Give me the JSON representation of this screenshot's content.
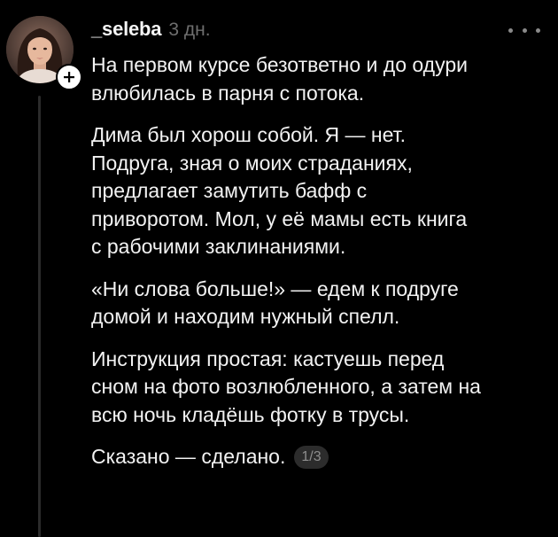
{
  "author": {
    "username": "_seleba",
    "time_ago": "3 дн."
  },
  "icons": {
    "avatar": "user-avatar-photo",
    "follow": "plus-icon",
    "more": "more-horizontal-icon"
  },
  "post": {
    "paragraphs": [
      [
        "На первом курсе безответно и до одури",
        "влюбилась в парня с потока."
      ],
      [
        "Дима был хорош собой. Я — нет.",
        "Подруга, зная о моих страданиях,",
        "предлагает замутить бафф с",
        "приворотом. Мол, у её мамы есть книга",
        "с рабочими заклинаниями."
      ],
      [
        "«Ни слова больше!» — едем к подруге",
        "домой и находим нужный спелл."
      ],
      [
        "Инструкция простая: кастуешь перед",
        "сном на фото возлюбленного, а затем на",
        "всю ночь кладёшь фотку в трусы."
      ]
    ],
    "last_line": "Сказано — сделано.",
    "page_indicator": "1/3"
  },
  "colors": {
    "background": "#000000",
    "text": "#f2f2f2",
    "muted": "#6e6e6e",
    "thread_line": "#2b2b2b"
  }
}
